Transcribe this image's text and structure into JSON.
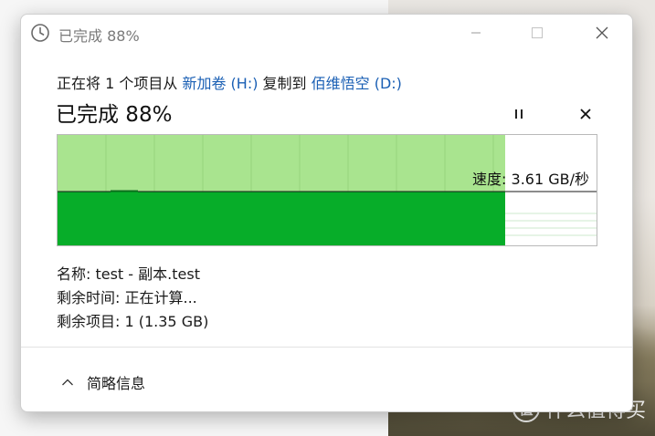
{
  "window": {
    "title": "已完成 88%",
    "icon": "clock-icon"
  },
  "transfer": {
    "prefix": "正在将 1 个项目从 ",
    "source": "新加卷 (H:)",
    "middle": " 复制到 ",
    "destination": "佰维悟空 (D:)"
  },
  "status": {
    "title": "已完成 88%",
    "progress_percent": 88
  },
  "graph": {
    "speed": "速度: 3.61 GB/秒"
  },
  "details": {
    "name": "名称: test - 副本.test",
    "time_remaining": "剩余时间: 正在计算...",
    "items_remaining": "剩余项目: 1 (1.35 GB)"
  },
  "footer": {
    "toggle_label": "简略信息"
  },
  "watermark": {
    "text": "什么值得买",
    "logo": "值"
  },
  "colors": {
    "bar_fill": "#07ad29",
    "bar_light": "#a9e48f",
    "link": "#1a5fb4"
  }
}
